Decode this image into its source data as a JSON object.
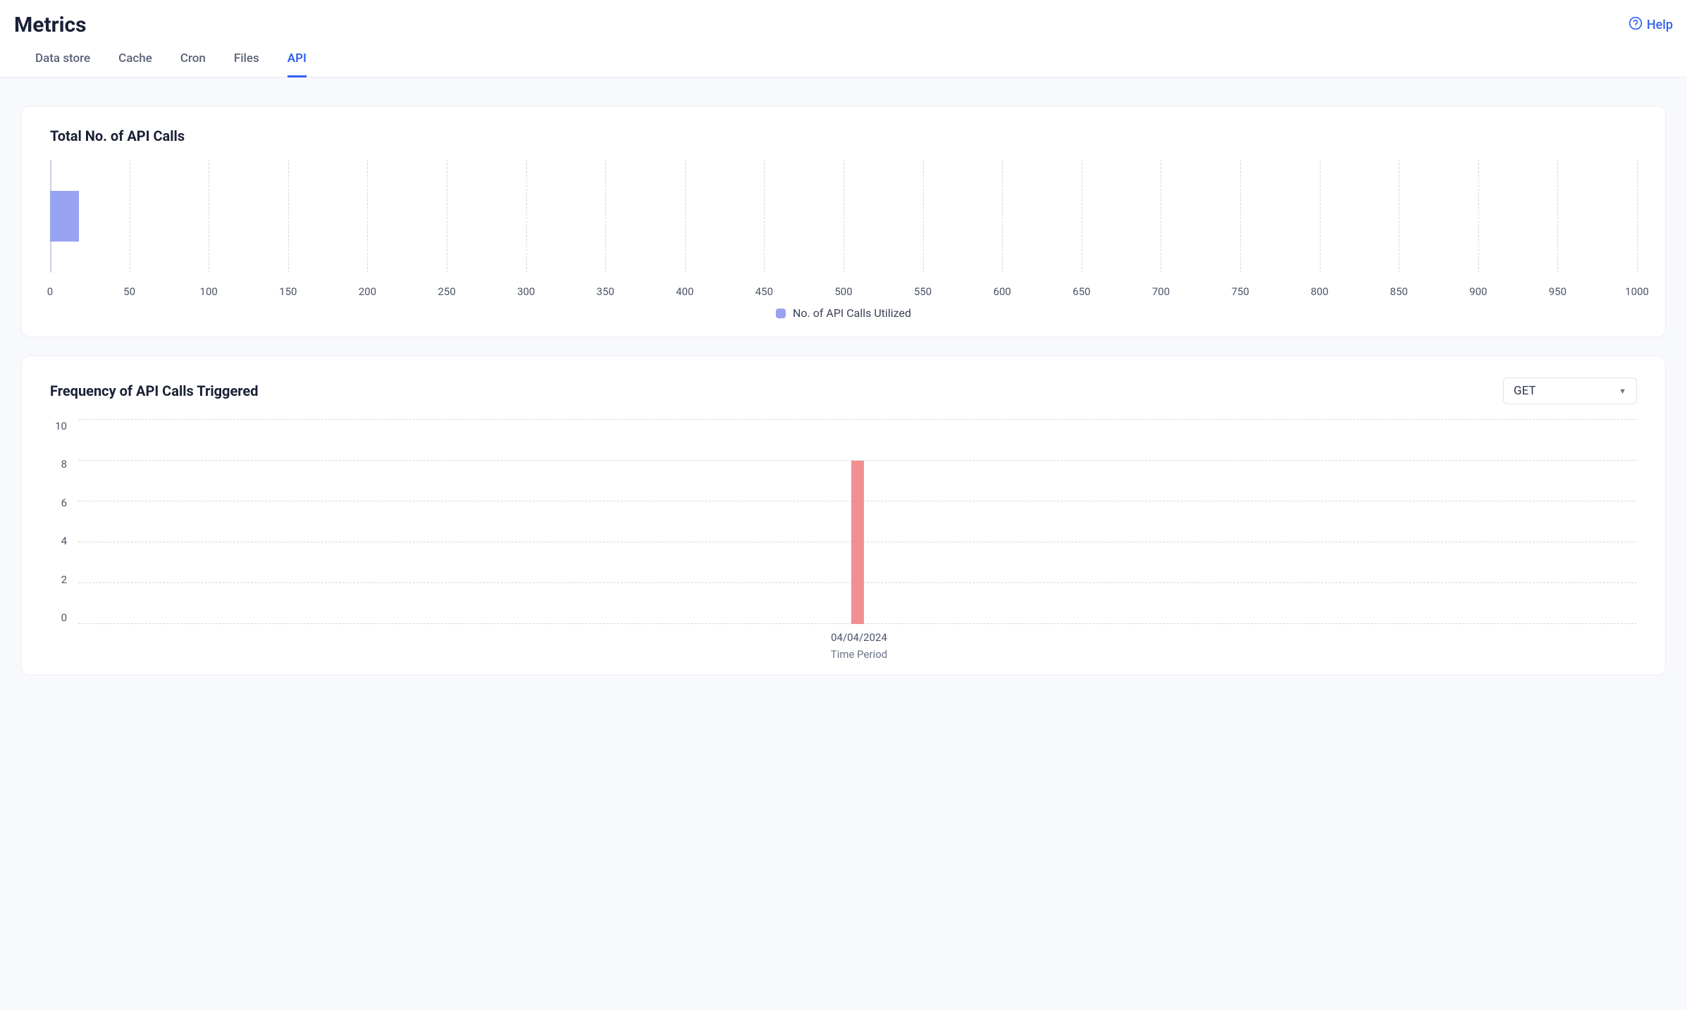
{
  "page_title": "Metrics",
  "help_label": "Help",
  "tabs": [
    {
      "label": "Data store",
      "active": false
    },
    {
      "label": "Cache",
      "active": false
    },
    {
      "label": "Cron",
      "active": false
    },
    {
      "label": "Files",
      "active": false
    },
    {
      "label": "API",
      "active": true
    }
  ],
  "chart_data": [
    {
      "type": "bar",
      "orientation": "horizontal",
      "title": "Total No. of API Calls",
      "categories": [
        "No. of API Calls Utilized"
      ],
      "values": [
        18
      ],
      "xlabel": "",
      "ylabel": "",
      "xlim": [
        0,
        1000
      ],
      "xticks": [
        0,
        50,
        100,
        150,
        200,
        250,
        300,
        350,
        400,
        450,
        500,
        550,
        600,
        650,
        700,
        750,
        800,
        850,
        900,
        950,
        1000
      ],
      "legend_label": "No. of API Calls Utilized",
      "bar_color": "#98a3f2"
    },
    {
      "type": "bar",
      "orientation": "vertical",
      "title": "Frequency of API Calls Triggered",
      "categories": [
        "04/04/2024"
      ],
      "values": [
        8
      ],
      "xlabel": "Time Period",
      "ylabel": "",
      "ylim": [
        0,
        10
      ],
      "yticks": [
        0,
        2,
        4,
        6,
        8,
        10
      ],
      "filter_selected": "GET",
      "bar_color": "#f29091"
    }
  ]
}
